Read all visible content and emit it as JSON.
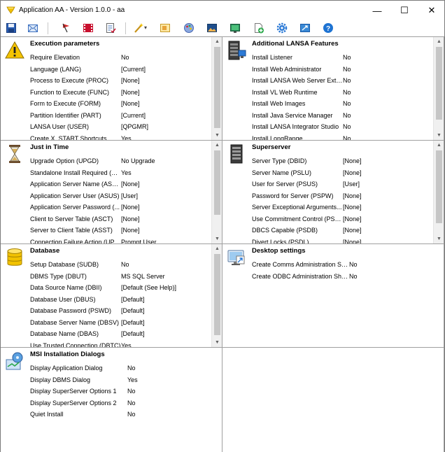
{
  "window": {
    "title": "Application AA - Version 1.0.0 - aa",
    "minimize": "—",
    "maximize": "☐",
    "close": "✕"
  },
  "toolbar": {
    "buttons": [
      "save-icon",
      "email-icon",
      "flag-icon",
      "film-icon",
      "checklist-icon",
      "wand-icon",
      "image-edit-icon",
      "palette-icon",
      "picture-icon",
      "screen-icon",
      "add-document-icon",
      "gear-icon",
      "resize-icon",
      "help-icon"
    ],
    "dropdown": "▾"
  },
  "panels": {
    "execution": {
      "title": "Execution parameters",
      "icon": "warning-icon",
      "rows": [
        {
          "label": "Require Elevation",
          "value": "No"
        },
        {
          "label": "Language (LANG)",
          "value": "[Current]"
        },
        {
          "label": "Process to Execute (PROC)",
          "value": "[None]"
        },
        {
          "label": "Function to Execute (FUNC)",
          "value": "[None]"
        },
        {
          "label": "Form to Execute (FORM)",
          "value": "[None]"
        },
        {
          "label": "Partition Identifier (PART)",
          "value": "[Current]"
        },
        {
          "label": "LANSA User (USER)",
          "value": "[QPGMR]"
        },
        {
          "label": "Create X_START Shortcuts",
          "value": "Yes"
        }
      ]
    },
    "features": {
      "title": "Additional LANSA Features",
      "icon": "server-rack-icon",
      "rows": [
        {
          "label": "Install Listener",
          "value": "No"
        },
        {
          "label": "Install Web Administrator",
          "value": "No"
        },
        {
          "label": "Install LANSA Web Server Exte...",
          "value": "No"
        },
        {
          "label": "Install VL Web Runtime",
          "value": "No"
        },
        {
          "label": "Install Web Images",
          "value": "No"
        },
        {
          "label": "Install Java Service Manager",
          "value": "No"
        },
        {
          "label": "Install LANSA Integrator Studio",
          "value": "No"
        },
        {
          "label": "Install LongRange",
          "value": "No"
        }
      ]
    },
    "jit": {
      "title": "Just in Time",
      "icon": "hourglass-icon",
      "rows": [
        {
          "label": "Upgrade Option (UPGD)",
          "value": "No Upgrade"
        },
        {
          "label": "Standalone Install Required (U...",
          "value": "Yes"
        },
        {
          "label": "Application Server Name (ASLU)",
          "value": "[None]"
        },
        {
          "label": "Application Server User (ASUS)",
          "value": "[User]"
        },
        {
          "label": "Application Server Password (...",
          "value": "[None]"
        },
        {
          "label": "Client to Server Table (ASCT)",
          "value": "[None]"
        },
        {
          "label": "Server to Client Table (ASST)",
          "value": "[None]"
        },
        {
          "label": "Connection Failure Action (UPC...",
          "value": "Prompt User"
        }
      ]
    },
    "superserver": {
      "title": "Superserver",
      "icon": "server-tower-icon",
      "rows": [
        {
          "label": "Server Type (DBID)",
          "value": "[None]"
        },
        {
          "label": "Server Name (PSLU)",
          "value": "[None]"
        },
        {
          "label": "User for Server (PSUS)",
          "value": "[User]"
        },
        {
          "label": "Password for Server (PSPW)",
          "value": "[None]"
        },
        {
          "label": "Server Exceptional Arguments...",
          "value": "[None]"
        },
        {
          "label": "Use Commitment Control (PSCC)",
          "value": "[None]"
        },
        {
          "label": "DBCS Capable (PSDB)",
          "value": "[None]"
        },
        {
          "label": "Divert Locks (PSDL)",
          "value": "[None]"
        }
      ]
    },
    "database": {
      "title": "Database",
      "icon": "database-icon",
      "rows": [
        {
          "label": "Setup Database (SUDB)",
          "value": "No"
        },
        {
          "label": "DBMS Type (DBUT)",
          "value": "MS SQL Server"
        },
        {
          "label": "Data Source Name (DBII)",
          "value": "[Default (See Help)]"
        },
        {
          "label": "Database User (DBUS)",
          "value": "[Default]"
        },
        {
          "label": "Database Password (PSWD)",
          "value": "[Default]"
        },
        {
          "label": "Database Server Name (DBSV)",
          "value": "[Default]"
        },
        {
          "label": "Database Name (DBAS)",
          "value": "[Default]"
        },
        {
          "label": "Use Trusted Connection (DBTC)",
          "value": "Yes"
        }
      ]
    },
    "desktop": {
      "title": "Desktop settings",
      "icon": "desktop-shortcut-icon",
      "rows": [
        {
          "label": "Create Comms Administration Sh...",
          "value": "No"
        },
        {
          "label": "Create ODBC Administration Sho...",
          "value": "No"
        }
      ]
    },
    "msi": {
      "title": "MSI Installation Dialogs",
      "icon": "msi-installer-icon",
      "rows": [
        {
          "label": "Display Application Dialog",
          "value": "No"
        },
        {
          "label": "Display DBMS Dialog",
          "value": "Yes"
        },
        {
          "label": "Display SuperServer Options 1",
          "value": "No"
        },
        {
          "label": "Display SuperServer Options 2",
          "value": "No"
        },
        {
          "label": "Quiet Install",
          "value": "No"
        }
      ]
    }
  },
  "scroll": {
    "up": "▲",
    "down": "▼"
  }
}
